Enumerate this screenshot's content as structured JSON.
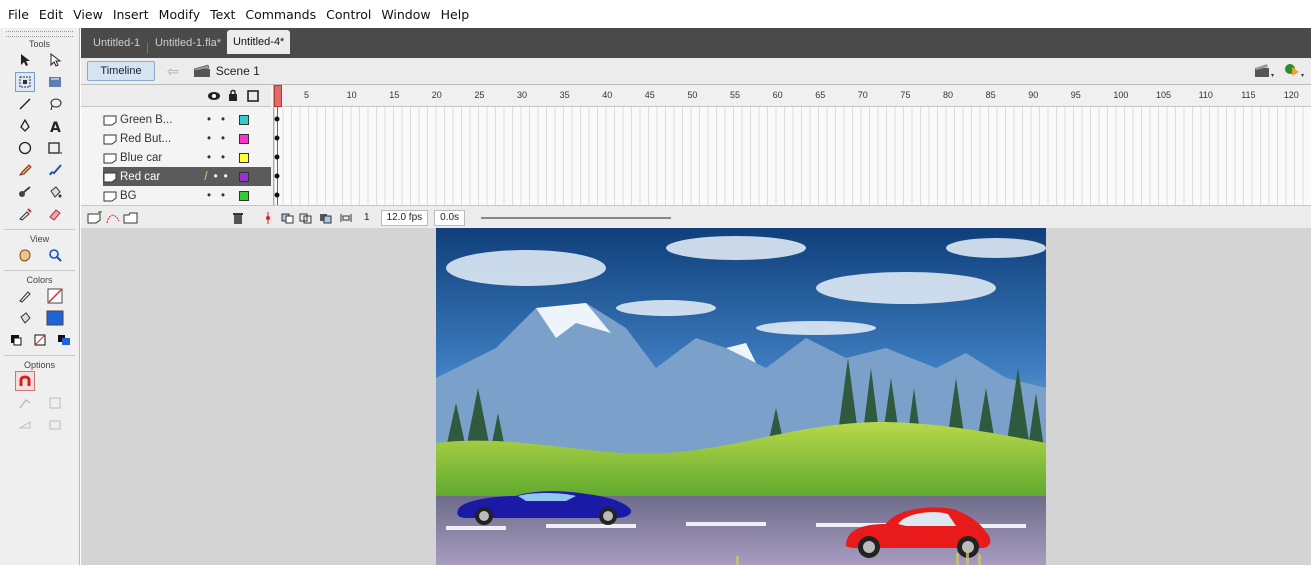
{
  "menu": [
    "File",
    "Edit",
    "View",
    "Insert",
    "Modify",
    "Text",
    "Commands",
    "Control",
    "Window",
    "Help"
  ],
  "tools": {
    "title": "Tools",
    "view_title": "View",
    "colors_title": "Colors",
    "options_title": "Options"
  },
  "tabs": [
    "Untitled-1",
    "Untitled-1.fla*",
    "Untitled-4*"
  ],
  "editbar": {
    "timeline_label": "Timeline",
    "scene_label": "Scene 1"
  },
  "layers": [
    {
      "name": "Green B...",
      "color": "#33cccc"
    },
    {
      "name": "Red But...",
      "color": "#ff33cc"
    },
    {
      "name": "Blue car",
      "color": "#ffff33"
    },
    {
      "name": "Red car",
      "color": "#9933cc"
    },
    {
      "name": "BG",
      "color": "#33cc33"
    }
  ],
  "ruler": [
    "5",
    "10",
    "15",
    "20",
    "25",
    "30",
    "35",
    "40",
    "45",
    "50",
    "55",
    "60",
    "65",
    "70",
    "75",
    "80",
    "85",
    "90",
    "95",
    "100",
    "105",
    "110",
    "115",
    "120"
  ],
  "timeline_footer": {
    "frame": "1",
    "fps": "12.0 fps",
    "time": "0.0s"
  },
  "colors": {
    "accent": "#d6e3f1",
    "playhead": "#e26a6a",
    "blue_car": "#1a1aa6",
    "red_car": "#e81a1a"
  }
}
